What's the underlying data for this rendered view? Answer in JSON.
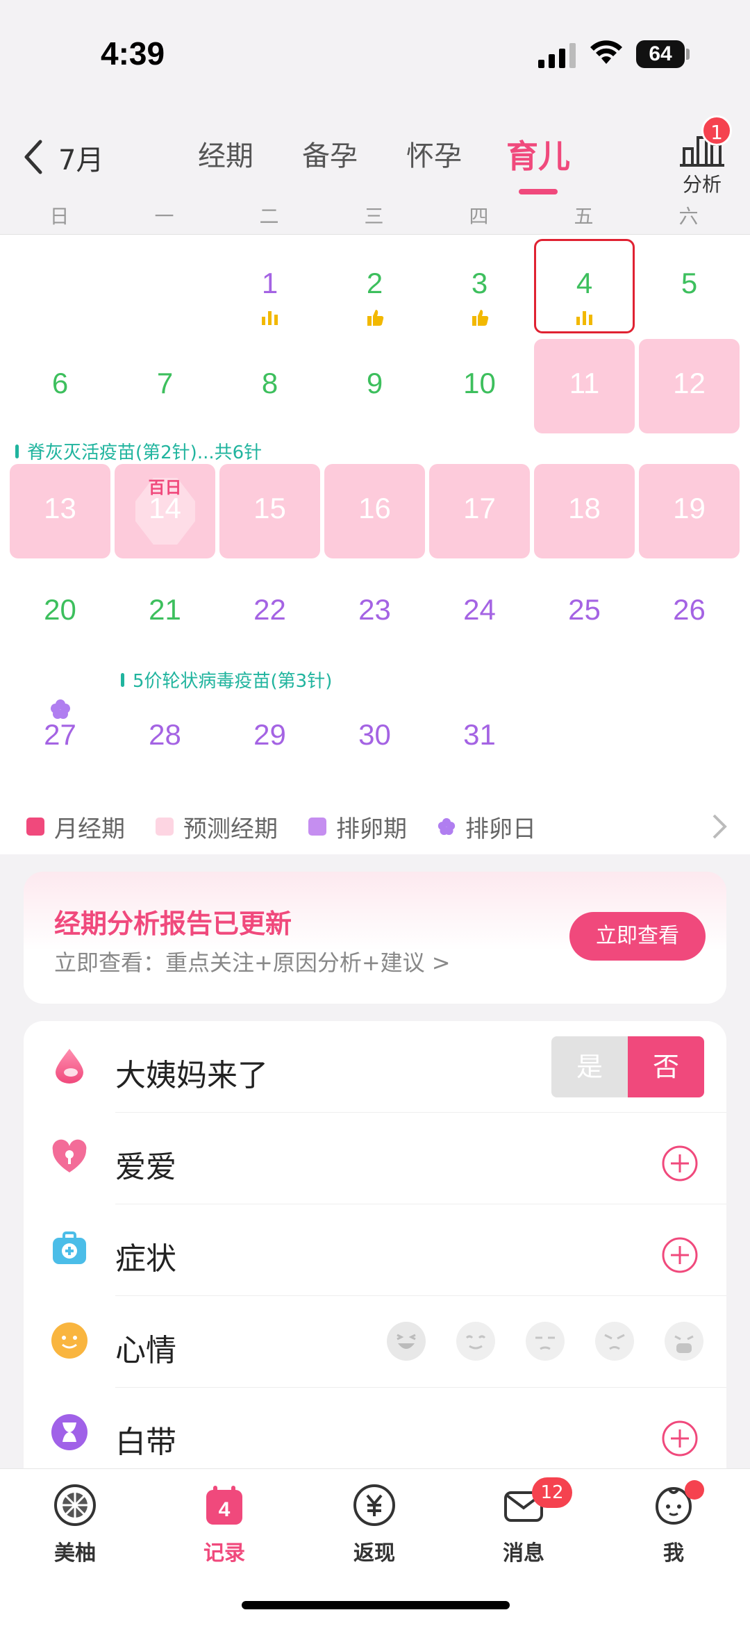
{
  "status": {
    "time": "4:39",
    "battery": "64"
  },
  "header": {
    "month": "7月",
    "tabs": [
      "经期",
      "备孕",
      "怀孕",
      "育儿"
    ],
    "active_tab": "育儿",
    "analysis_label": "分析",
    "analysis_badge": "1"
  },
  "weekdays": [
    "日",
    "一",
    "二",
    "三",
    "四",
    "五",
    "六"
  ],
  "calendar": {
    "days": [
      "1",
      "2",
      "3",
      "4",
      "5",
      "6",
      "7",
      "8",
      "9",
      "10",
      "11",
      "12",
      "13",
      "14",
      "15",
      "16",
      "17",
      "18",
      "19",
      "20",
      "21",
      "22",
      "23",
      "24",
      "25",
      "26",
      "27",
      "28",
      "29",
      "30",
      "31"
    ],
    "festival_14": "百日",
    "vaccine_1": "脊灰灭活疫苗(第2针)...共6针",
    "vaccine_2": "5价轮状病毒疫苗(第3针)"
  },
  "legend": {
    "items": [
      "月经期",
      "预测经期",
      "排卵期",
      "排卵日"
    ],
    "colors": [
      "#f0497c",
      "#fdd5e2",
      "#c58ef0",
      "#b07ef0"
    ]
  },
  "report": {
    "title": "经期分析报告已更新",
    "subtitle": "立即查看：重点关注+原因分析+建议 >",
    "button": "立即查看"
  },
  "records": {
    "period": {
      "label": "大姨妈来了",
      "yes": "是",
      "no": "否",
      "selected": "否"
    },
    "love": {
      "label": "爱爱"
    },
    "symptoms": {
      "label": "症状"
    },
    "mood": {
      "label": "心情"
    },
    "discharge": {
      "label": "白带"
    }
  },
  "nav": {
    "items": [
      "美柚",
      "记录",
      "返现",
      "消息",
      "我"
    ],
    "record_day": "4",
    "messages_badge": "12",
    "active": "记录"
  },
  "colors": {
    "accent": "#f0497c",
    "purple": "#a463e3",
    "green": "#3dbf5d",
    "pink_cell": "#fdcbdb",
    "vaccine": "#20b49e"
  }
}
